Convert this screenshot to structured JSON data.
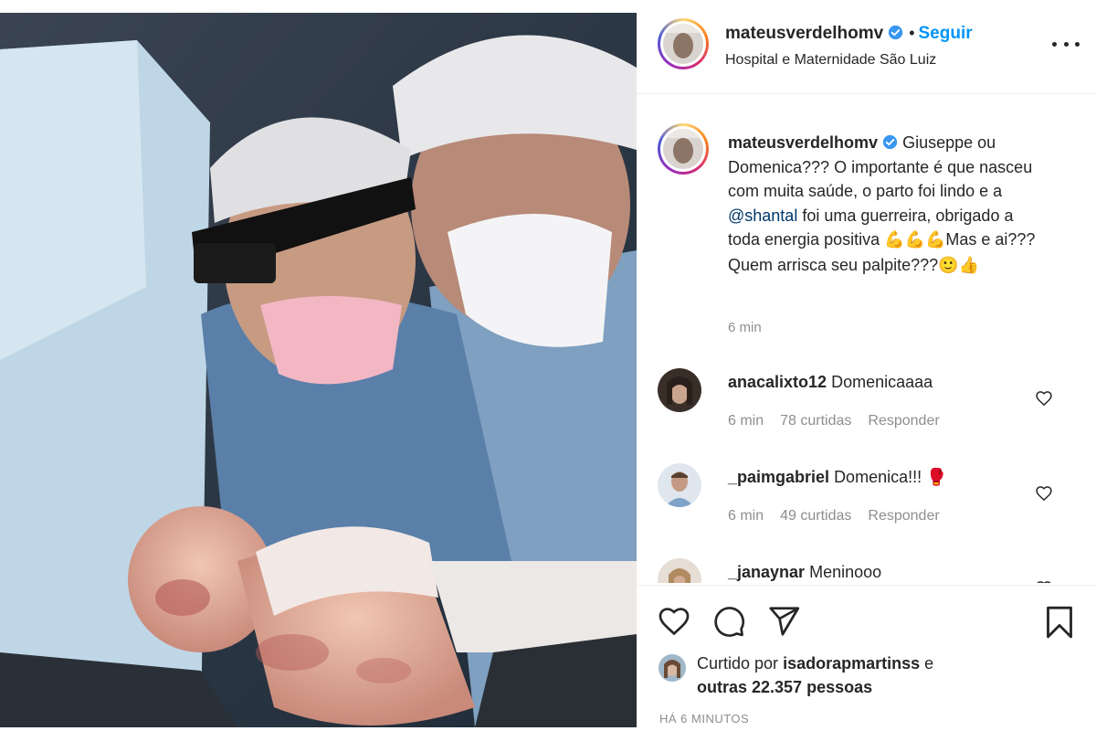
{
  "post": {
    "image_alt": "Newborn baby held by doctors in surgical masks",
    "header": {
      "username": "mateusverdelhomv",
      "dot": "•",
      "follow_label": "Seguir",
      "location": "Hospital e Maternidade São Luiz",
      "more_icon": "more-horizontal-icon"
    },
    "caption": {
      "username": "mateusverdelhomv",
      "text_part1": "Giuseppe ou Domenica??? O importante é que nasceu com muita saúde, o parto foi lindo e a ",
      "mention": "@shantal",
      "text_part2": " foi uma guerreira, obrigado a toda energia positiva ",
      "emoji1": "💪💪💪",
      "text_part3": "Mas e ai??? Quem arrisca seu palpite???",
      "emoji2": "🙂👍",
      "time": "6 min"
    },
    "comments": [
      {
        "username": "anacalixto12",
        "text": "Domenicaaaa",
        "time": "6 min",
        "likes": "78 curtidas",
        "reply": "Responder"
      },
      {
        "username": "_paimgabriel",
        "text": "Domenica!!!",
        "emoji": "🥊",
        "time": "6 min",
        "likes": "49 curtidas",
        "reply": "Responder"
      },
      {
        "username": "_janaynar",
        "text": "Meninooo"
      }
    ],
    "actions": {
      "like_icon": "heart-icon",
      "comment_icon": "comment-icon",
      "share_icon": "send-icon",
      "save_icon": "bookmark-icon"
    },
    "likes": {
      "prefix": "Curtido por",
      "user": "isadorapmartinss",
      "connector": "e",
      "others": "outras 22.357 pessoas"
    },
    "timestamp": "HÁ 6 MINUTOS"
  },
  "colors": {
    "follow_blue": "#0095f6",
    "verified_blue": "#3897f0",
    "mention_blue": "#00376b",
    "muted_gray": "#8e8e8e"
  }
}
